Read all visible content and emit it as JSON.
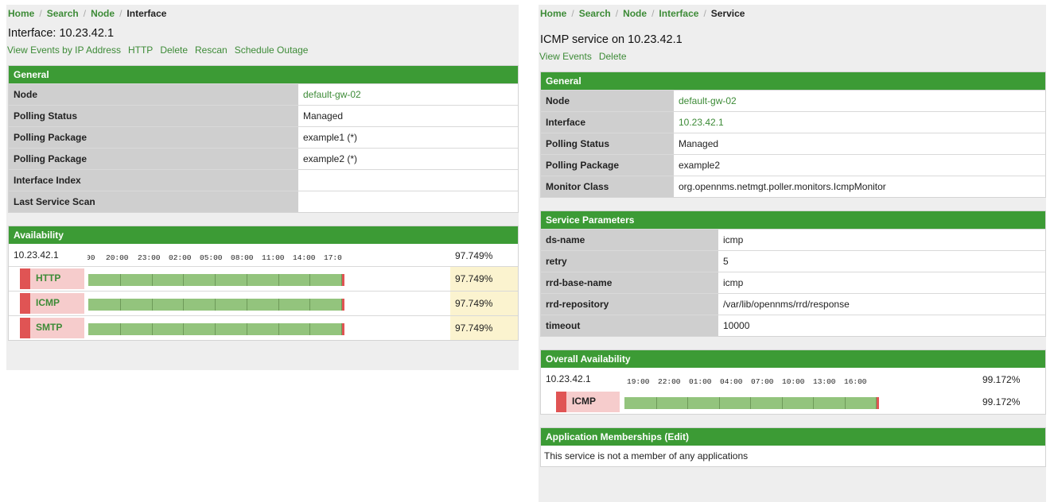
{
  "left": {
    "breadcrumb": [
      "Home",
      "Search",
      "Node",
      "Interface"
    ],
    "title": "Interface: 10.23.42.1",
    "actions": [
      "View Events by IP Address",
      "HTTP",
      "Delete",
      "Rescan",
      "Schedule Outage"
    ],
    "general": {
      "heading": "General",
      "rows": [
        {
          "key": "Node",
          "value": "default-gw-02",
          "link": true
        },
        {
          "key": "Polling Status",
          "value": "Managed",
          "link": false
        },
        {
          "key": "Polling Package",
          "value": "example1 (*)",
          "link": false
        },
        {
          "key": "Polling Package",
          "value": "example2 (*)",
          "link": false
        },
        {
          "key": "Interface Index",
          "value": "",
          "link": false
        },
        {
          "key": "Last Service Scan",
          "value": "",
          "link": false
        }
      ]
    },
    "availability": {
      "heading": "Availability",
      "ip": "10.23.42.1",
      "timeline": [
        "00",
        "20:00",
        "23:00",
        "02:00",
        "05:00",
        "08:00",
        "11:00",
        "14:00",
        "17:0"
      ],
      "overall_pct": "97.749%",
      "services": [
        {
          "name": "HTTP",
          "pct": "97.749%",
          "fraction": 0.97749
        },
        {
          "name": "ICMP",
          "pct": "97.749%",
          "fraction": 0.97749
        },
        {
          "name": "SMTP",
          "pct": "97.749%",
          "fraction": 0.97749
        }
      ]
    }
  },
  "right": {
    "breadcrumb": [
      "Home",
      "Search",
      "Node",
      "Interface",
      "Service"
    ],
    "title": "ICMP service on 10.23.42.1",
    "actions": [
      "View Events",
      "Delete"
    ],
    "general": {
      "heading": "General",
      "rows": [
        {
          "key": "Node",
          "value": "default-gw-02",
          "link": true
        },
        {
          "key": "Interface",
          "value": "10.23.42.1",
          "link": true
        },
        {
          "key": "Polling Status",
          "value": "Managed",
          "link": false
        },
        {
          "key": "Polling Package",
          "value": "example2",
          "link": false
        },
        {
          "key": "Monitor Class",
          "value": "org.opennms.netmgt.poller.monitors.IcmpMonitor",
          "link": false
        }
      ]
    },
    "service_parameters": {
      "heading": "Service Parameters",
      "rows": [
        {
          "key": "ds-name",
          "value": "icmp"
        },
        {
          "key": "retry",
          "value": "5"
        },
        {
          "key": "rrd-base-name",
          "value": "icmp"
        },
        {
          "key": "rrd-repository",
          "value": "/var/lib/opennms/rrd/response"
        },
        {
          "key": "timeout",
          "value": "10000"
        }
      ]
    },
    "overall_availability": {
      "heading": "Overall Availability",
      "ip": "10.23.42.1",
      "timeline": [
        "19:00",
        "22:00",
        "01:00",
        "04:00",
        "07:00",
        "10:00",
        "13:00",
        "16:00"
      ],
      "overall_pct": "99.172%",
      "services": [
        {
          "name": "ICMP",
          "pct": "99.172%",
          "fraction": 0.99172
        }
      ]
    },
    "applications": {
      "heading": "Application Memberships (Edit)",
      "text": "This service is not a member of any applications"
    }
  },
  "colors": {
    "accent": "#3c9b35",
    "link": "#3d8b37",
    "bar_green": "#93c47d",
    "outage_red": "#e05454"
  }
}
